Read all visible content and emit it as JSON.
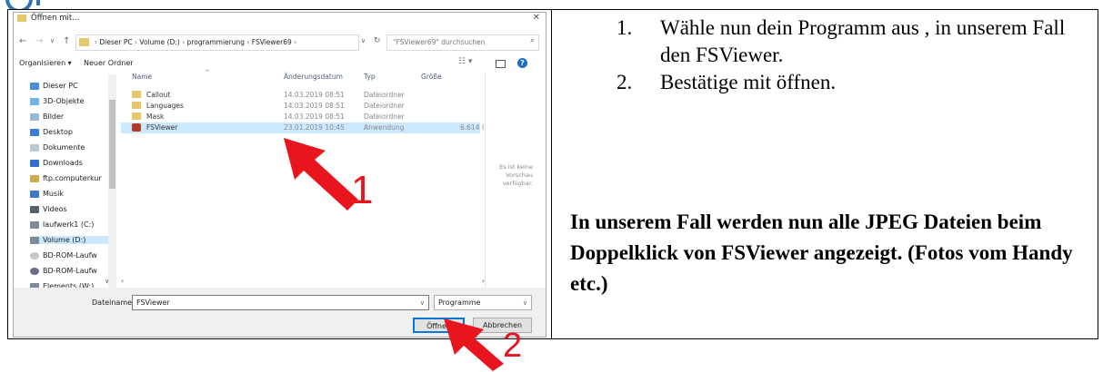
{
  "dialog": {
    "title": "Öffnen mit...",
    "breadcrumb": [
      "Dieser PC",
      "Volume (D:)",
      "programmierung",
      "FSViewer69"
    ],
    "search_placeholder": "\"FSViewer69\" durchsuchen",
    "toolbar": {
      "organize": "Organisieren ▾",
      "new_folder": "Neuer Ordner"
    },
    "tree": [
      {
        "label": "Dieser PC",
        "icon": "pc-icon"
      },
      {
        "label": "3D-Objekte",
        "icon": "cube-icon"
      },
      {
        "label": "Bilder",
        "icon": "image-icon"
      },
      {
        "label": "Desktop",
        "icon": "desktop-icon"
      },
      {
        "label": "Dokumente",
        "icon": "document-icon"
      },
      {
        "label": "Downloads",
        "icon": "download-icon"
      },
      {
        "label": "ftp.computerkur",
        "icon": "network-icon"
      },
      {
        "label": "Musik",
        "icon": "music-icon"
      },
      {
        "label": "Videos",
        "icon": "video-icon"
      },
      {
        "label": "laufwerk1 (C:)",
        "icon": "drive-icon"
      },
      {
        "label": "Volume (D:)",
        "icon": "drive-icon"
      },
      {
        "label": "BD-ROM-Laufw",
        "icon": "disc-icon"
      },
      {
        "label": "BD-ROM-Laufw",
        "icon": "disc-icon"
      },
      {
        "label": "Elements (W:)",
        "icon": "drive-icon"
      }
    ],
    "columns": [
      "Name",
      "Änderungsdatum",
      "Typ",
      "Größe"
    ],
    "files": [
      {
        "name": "Callout",
        "date": "14.03.2019 08:51",
        "type": "Dateiordner",
        "size": ""
      },
      {
        "name": "Languages",
        "date": "14.03.2019 08:51",
        "type": "Dateiordner",
        "size": ""
      },
      {
        "name": "Mask",
        "date": "14.03.2019 08:51",
        "type": "Dateiordner",
        "size": ""
      },
      {
        "name": "FSViewer",
        "date": "23.01.2019 10:45",
        "type": "Anwendung",
        "size": "6.614 I"
      }
    ],
    "preview_text": "Es ist keine Vorschau verfügbar.",
    "filename_label": "Dateiname:",
    "filename_value": "FSViewer",
    "filetype_value": "Programme",
    "open_button": "Öffnen",
    "cancel_button": "Abbrechen"
  },
  "annotations": {
    "arrow1_number": "1",
    "arrow2_number": "2"
  },
  "instructions": {
    "steps": [
      "Wähle nun dein Programm aus , in unserem Fall den FSViewer.",
      "Bestätige mit öffnen."
    ],
    "note": "In unserem Fall werden nun alle JPEG Dateien beim Doppelklick von FSViewer angezeigt. (Fotos vom Handy etc.)"
  },
  "colors": {
    "accent": "#0078d7",
    "selection": "#cce8ff",
    "arrow": "#e8141e"
  }
}
